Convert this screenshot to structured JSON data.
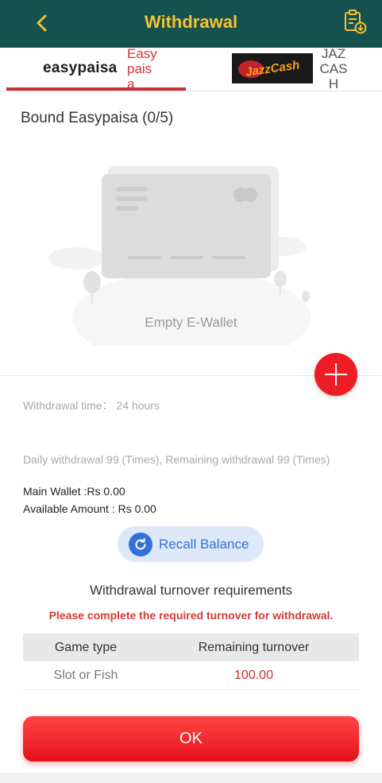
{
  "header": {
    "title": "Withdrawal",
    "back_icon": "chevron-left-icon",
    "history_icon": "clipboard-download-icon",
    "bg_color": "#15514f",
    "title_color": "#f6c231"
  },
  "tabs": [
    {
      "logo_text": "easypaisa",
      "label": "Easypaisa",
      "active": true
    },
    {
      "logo_text": "JazzCash",
      "label": "JAZCASH",
      "active": false
    }
  ],
  "bound": {
    "label": "Bound Easypaisa (0/5)"
  },
  "empty_state": {
    "text": "Empty E-Wallet",
    "add_icon": "plus-icon"
  },
  "info": {
    "withdrawal_time": "Withdrawal time：  24 hours",
    "daily": "Daily withdrawal 99 (Times), Remaining withdrawal 99 (Times)",
    "main_wallet": "Main Wallet :Rs 0.00",
    "available_amount": "Available Amount : Rs 0.00"
  },
  "recall": {
    "label": "Recall Balance",
    "icon": "refresh-icon"
  },
  "turnover": {
    "title": "Withdrawal turnover requirements",
    "note": "Please complete the required turnover for withdrawal.",
    "headers": [
      "Game type",
      "Remaining turnover"
    ],
    "rows": [
      {
        "game_type": "Slot or Fish",
        "remaining": "100.00"
      }
    ]
  },
  "ok_button": {
    "label": "OK",
    "color": "#ee1c25"
  }
}
